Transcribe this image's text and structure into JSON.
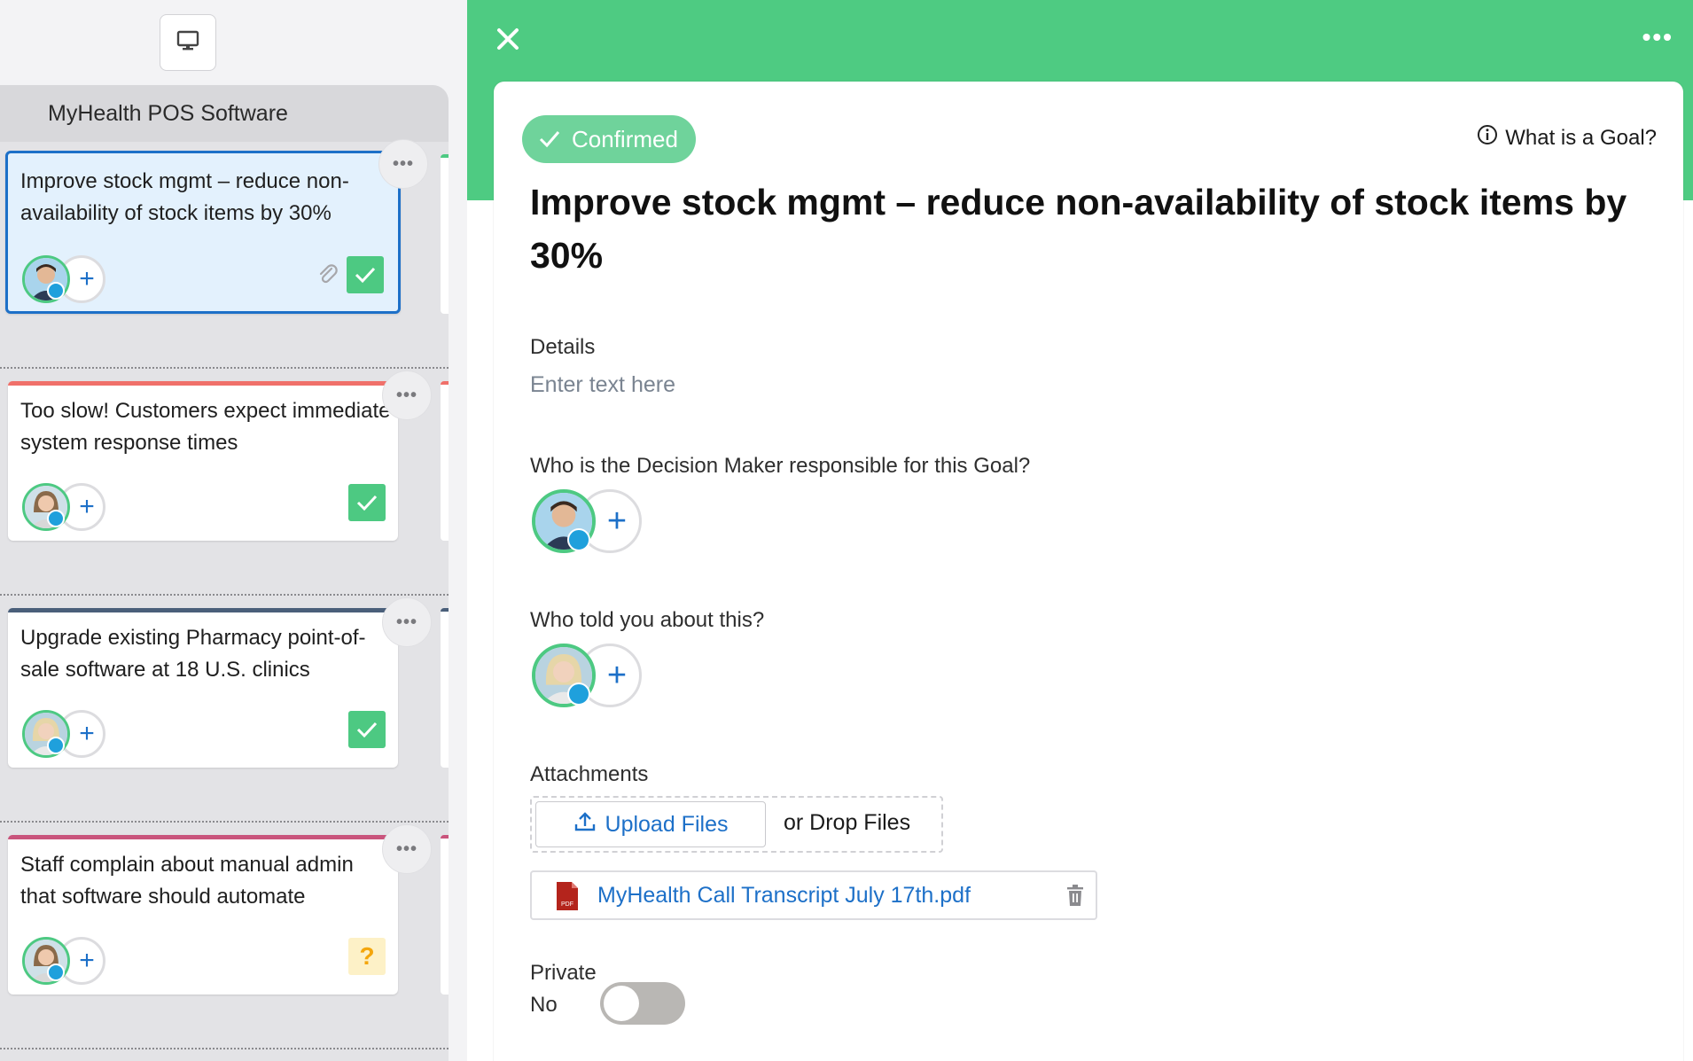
{
  "column": {
    "title": "MyHealth POS Software"
  },
  "cards": [
    {
      "title": "Improve stock mgmt – reduce non-availability of stock items by 30%",
      "selected": true,
      "bar_color": "",
      "status": "check",
      "has_attachment": true
    },
    {
      "title": "Too slow! Customers expect immediate system response times",
      "selected": false,
      "bar_color": "#f0706a",
      "status": "check",
      "has_attachment": false
    },
    {
      "title": "Upgrade existing Pharmacy point-of-sale software at 18 U.S. clinics",
      "selected": false,
      "bar_color": "#4a5f7a",
      "status": "check",
      "has_attachment": false
    },
    {
      "title": "Staff complain about manual admin that software should automate",
      "selected": false,
      "bar_color": "#c9547c",
      "status": "question",
      "has_attachment": false
    }
  ],
  "card_status": {
    "question_mark": "?"
  },
  "panel": {
    "status_label": "Confirmed",
    "help_link": "What is a Goal?",
    "goal_title": "Improve stock mgmt – reduce non-availability of stock items by 30%",
    "details_label": "Details",
    "details_placeholder": "Enter text here",
    "decision_maker_label": "Who is the Decision Maker responsible for this Goal?",
    "told_by_label": "Who told you about this?",
    "attachments_label": "Attachments",
    "upload_label": "Upload Files",
    "drop_label": "or Drop Files",
    "file_name": "MyHealth Call Transcript July 17th.pdf",
    "pdf_badge": "PDF",
    "private_label": "Private",
    "private_value": "No",
    "private_on": false
  },
  "colors": {
    "brand_green": "#4ecb82",
    "link_blue": "#1d70c8",
    "check_green": "#4dc982",
    "question_yellow": "#f4a60c"
  },
  "icons": {
    "present": "monitor-icon",
    "close": "close-icon",
    "more": "more-horizontal-icon",
    "info": "info-icon",
    "upload": "upload-icon",
    "pdf": "pdf-file-icon",
    "delete": "trash-icon"
  }
}
